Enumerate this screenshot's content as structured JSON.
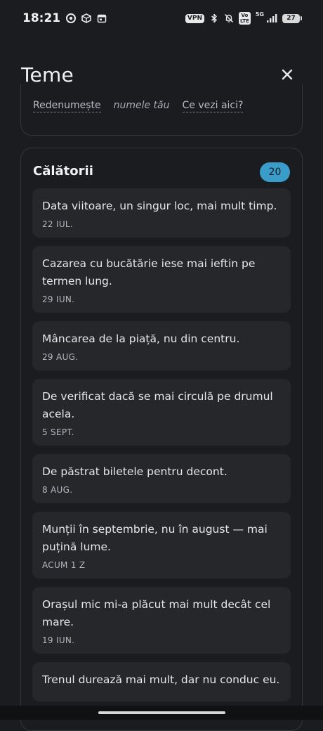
{
  "status_bar": {
    "time": "18:21",
    "vpn": "VPN",
    "volte": "Vo\nLTE",
    "network": "5G",
    "battery": "27"
  },
  "header": {
    "title": "Teme"
  },
  "top_links": {
    "rename": "Redenumește",
    "name_placeholder": "numele tău",
    "info": "Ce vezi aici?"
  },
  "group": {
    "title": "Călătorii",
    "count": "20",
    "items": [
      {
        "text": "Data viitoare, un singur loc, mai mult timp.",
        "date": "22 IUL."
      },
      {
        "text": "Cazarea cu bucătărie iese mai ieftin pe termen lung.",
        "date": "29 IUN."
      },
      {
        "text": "Mâncarea de la piață, nu din centru.",
        "date": "29 AUG."
      },
      {
        "text": "De verificat dacă se mai circulă pe drumul acela.",
        "date": "5 SEPT."
      },
      {
        "text": "De păstrat biletele pentru decont.",
        "date": "8 AUG."
      },
      {
        "text": "Munții în septembrie, nu în august — mai puțină lume.",
        "date": "ACUM 1 Z"
      },
      {
        "text": "Orașul mic mi-a plăcut mai mult decât cel mare.",
        "date": "19 IUN."
      },
      {
        "text": "Trenul durează mai mult, dar nu conduc eu.",
        "date": ""
      }
    ]
  }
}
